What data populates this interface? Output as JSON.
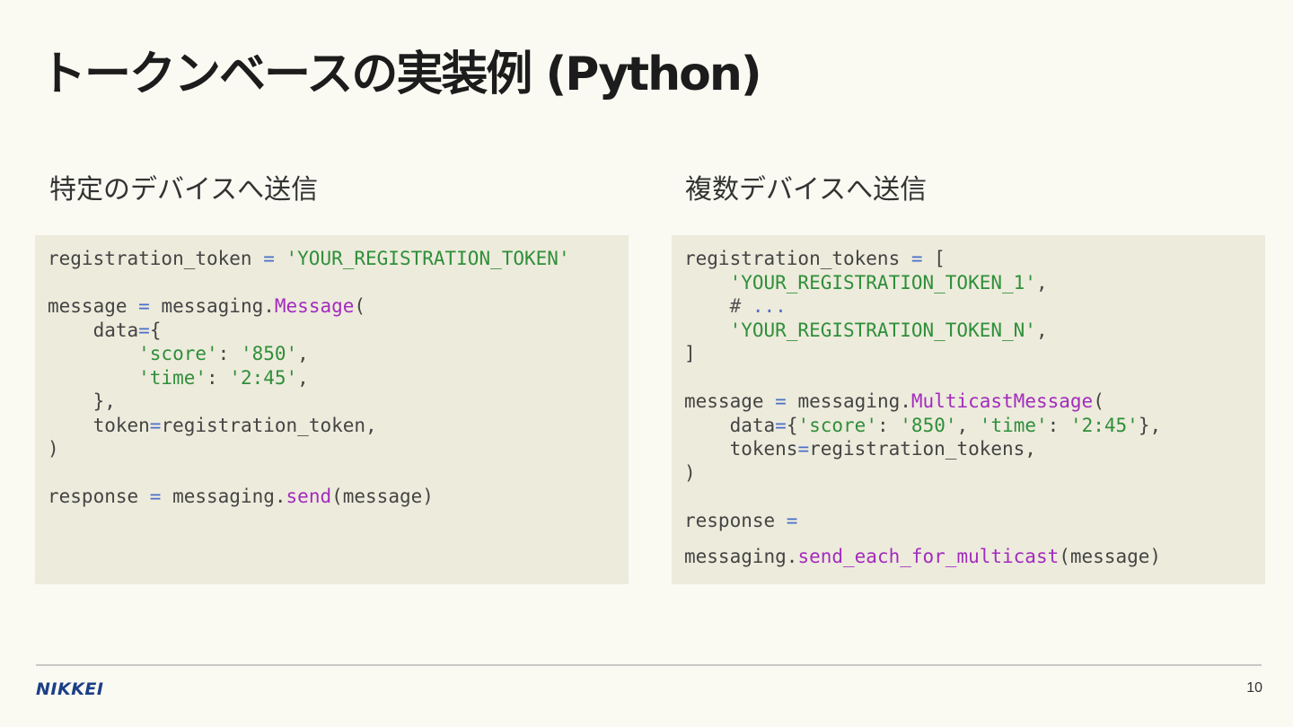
{
  "slide": {
    "title": "トークンベースの実装例 (Python)",
    "page_number": "10"
  },
  "brand": {
    "logo_text": "NIKKEI",
    "color": "#1c3f86"
  },
  "colors": {
    "background": "#fafaf3",
    "code_background": "#edebdc",
    "string": "#2f8f3a",
    "operator": "#4a6fc9",
    "call": "#a32bbd"
  },
  "left_panel": {
    "heading": "特定のデバイスへ送信",
    "code": {
      "l1_var": "registration_token",
      "l1_op": " = ",
      "l1_str": "'YOUR_REGISTRATION_TOKEN'",
      "l3_var": "message",
      "l3_op": " = ",
      "l3_obj": "messaging.",
      "l3_call": "Message",
      "l3_paren": "(",
      "l4_key": "    data",
      "l4_op": "=",
      "l4_brace": "{",
      "l5_k": "        'score'",
      "l5_colon": ": ",
      "l5_v": "'850'",
      "l5_comma": ",",
      "l6_k": "        'time'",
      "l6_colon": ": ",
      "l6_v": "'2:45'",
      "l6_comma": ",",
      "l7": "    },",
      "l8_key": "    token",
      "l8_op": "=",
      "l8_val": "registration_token,",
      "l9": ")",
      "l11_var": "response",
      "l11_op": " = ",
      "l11_obj": "messaging.",
      "l11_call": "send",
      "l11_args": "(message)"
    }
  },
  "right_panel": {
    "heading": "複数デバイスへ送信",
    "code": {
      "l1_var": "registration_tokens",
      "l1_op": " = ",
      "l1_bracket": "[",
      "l2_str": "    'YOUR_REGISTRATION_TOKEN_1'",
      "l2_comma": ",",
      "l3_hash": "    # ",
      "l3_dots": "...",
      "l4_str": "    'YOUR_REGISTRATION_TOKEN_N'",
      "l4_comma": ",",
      "l5": "]",
      "l7_var": "message",
      "l7_op": " = ",
      "l7_obj": "messaging.",
      "l7_call": "MulticastMessage",
      "l7_paren": "(",
      "l8_key": "    data",
      "l8_op": "=",
      "l8_brace": "{",
      "l8_k1": "'score'",
      "l8_c1": ": ",
      "l8_v1": "'850'",
      "l8_sep": ", ",
      "l8_k2": "'time'",
      "l8_c2": ": ",
      "l8_v2": "'2:45'",
      "l8_end": "},",
      "l9_key": "    tokens",
      "l9_op": "=",
      "l9_val": "registration_tokens,",
      "l10": ")",
      "l12_var": "response",
      "l12_op": " =",
      "l13_obj": "messaging.",
      "l13_call": "send_each_for_multicast",
      "l13_args": "(message)"
    }
  }
}
